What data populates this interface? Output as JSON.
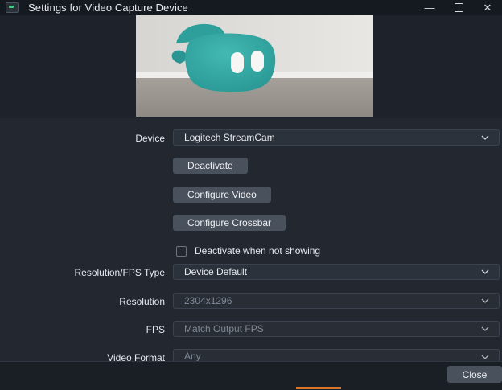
{
  "window": {
    "title": "Settings for Video Capture Device",
    "minimize_glyph": "—",
    "close_glyph": "✕"
  },
  "form": {
    "device_label": "Device",
    "device_value": "Logitech StreamCam",
    "deactivate_label": "Deactivate",
    "configure_video_label": "Configure Video",
    "configure_crossbar_label": "Configure Crossbar",
    "deactivate_when_not_showing_label": "Deactivate when not showing",
    "deactivate_when_not_showing_checked": false,
    "resolution_fps_type_label": "Resolution/FPS Type",
    "resolution_fps_type_value": "Device Default",
    "resolution_label": "Resolution",
    "resolution_value": "2304x1296",
    "fps_label": "FPS",
    "fps_value": "Match Output FPS",
    "video_format_label": "Video Format",
    "video_format_value": "Any"
  },
  "footer": {
    "close_label": "Close"
  },
  "colors": {
    "accent": "#3fd08d",
    "button_bg": "#49515c",
    "taskbar_accent": "#d8772a"
  },
  "icons": [
    "app-icon",
    "minimize-icon",
    "maximize-icon",
    "close-icon",
    "chevron-down-icon"
  ]
}
